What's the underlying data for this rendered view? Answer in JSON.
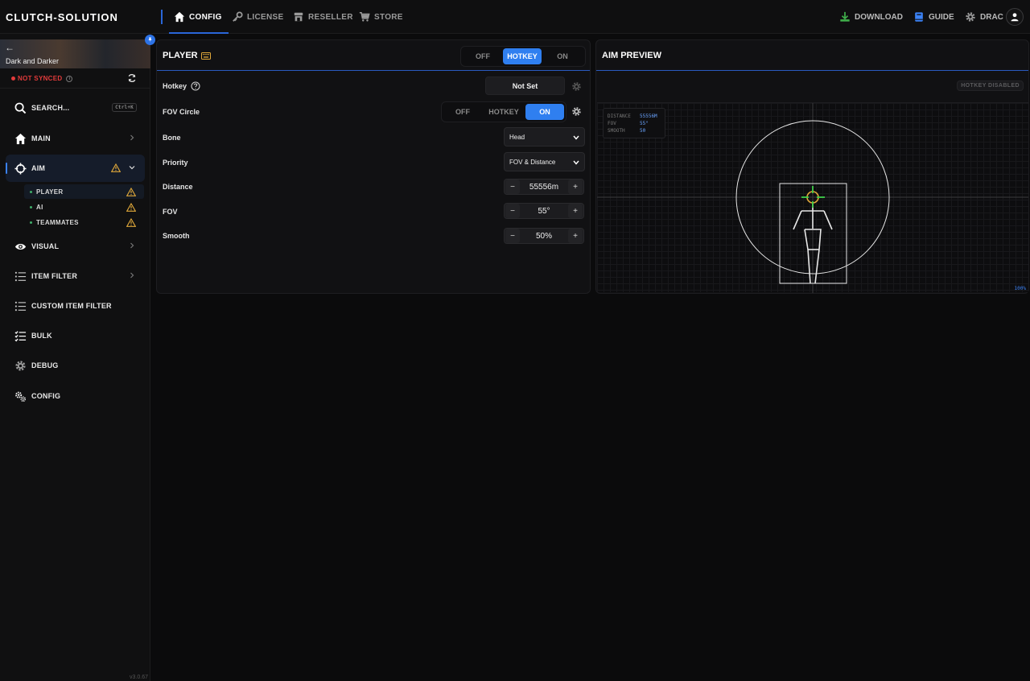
{
  "app": {
    "brand": "CLUTCH-SOLUTION",
    "version": "v3.0.67"
  },
  "topnav": {
    "tabs": [
      {
        "label": "CONFIG",
        "icon": "home-icon",
        "active": true
      },
      {
        "label": "LICENSE",
        "icon": "key-icon"
      },
      {
        "label": "RESELLER",
        "icon": "store-icon"
      },
      {
        "label": "STORE",
        "icon": "cart-icon"
      }
    ],
    "right": {
      "download": "DOWNLOAD",
      "guide": "GUIDE",
      "user": "DRAC"
    },
    "colors": {
      "accent": "#2f7ff0",
      "download": "#3fae4a",
      "guide": "#3b82f6"
    }
  },
  "sidebar": {
    "game": "Dark and Darker",
    "sync_status": "NOT SYNCED",
    "search": {
      "label": "SEARCH...",
      "shortcut": "Ctrl+K"
    },
    "items": {
      "main": "MAIN",
      "aim": "AIM",
      "visual": "VISUAL",
      "item_filter": "ITEM FILTER",
      "custom_item_filter": "CUSTOM ITEM FILTER",
      "bulk": "BULK",
      "debug": "DEBUG",
      "config": "CONFIG"
    },
    "aim_sub": {
      "player": "PLAYER",
      "ai": "AI",
      "teammates": "TEAMMATES"
    }
  },
  "player_panel": {
    "title": "PLAYER",
    "mode": {
      "off": "OFF",
      "hotkey": "HOTKEY",
      "on": "ON",
      "selected": "HOTKEY"
    },
    "rows": {
      "hotkey": {
        "label": "Hotkey",
        "value": "Not Set"
      },
      "fov_circle": {
        "label": "FOV Circle",
        "off": "OFF",
        "hotkey": "HOTKEY",
        "on": "ON",
        "selected": "ON"
      },
      "bone": {
        "label": "Bone",
        "value": "Head"
      },
      "priority": {
        "label": "Priority",
        "value": "FOV & Distance"
      },
      "distance": {
        "label": "Distance",
        "value": "55556m"
      },
      "fov": {
        "label": "FOV",
        "value": "55°"
      },
      "smooth": {
        "label": "Smooth",
        "value": "50%"
      }
    }
  },
  "preview_panel": {
    "title": "AIM PREVIEW",
    "badge": "HOTKEY DISABLED",
    "stats": {
      "distance_label": "DISTANCE",
      "distance_value": "55556M",
      "fov_label": "FOV",
      "fov_value": "55°",
      "smooth_label": "SMOOTH",
      "smooth_value": "50"
    },
    "corner": "100%"
  }
}
